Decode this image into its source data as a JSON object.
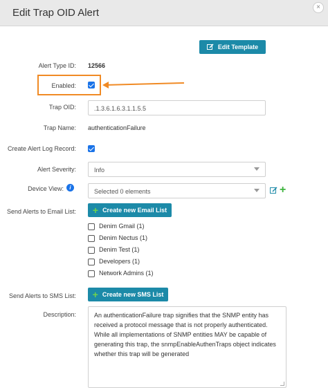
{
  "dialog": {
    "title": "Edit Trap OID Alert",
    "close_icon": "×"
  },
  "toolbar": {
    "edit_template_label": "Edit Template"
  },
  "fields": {
    "alert_type_id_label": "Alert Type ID:",
    "alert_type_id_value": "12566",
    "enabled_label": "Enabled:",
    "enabled_checked": true,
    "trap_oid_label": "Trap OID:",
    "trap_oid_value": ".1.3.6.1.6.3.1.1.5.5",
    "trap_name_label": "Trap Name:",
    "trap_name_value": "authenticationFailure",
    "create_log_label": "Create Alert Log Record:",
    "create_log_checked": true,
    "severity_label": "Alert Severity:",
    "severity_value": "Info",
    "device_view_label": "Device View:",
    "device_view_value": "Selected 0 elements",
    "email_label": "Send Alerts to Email List:",
    "new_email_button": "Create new Email List",
    "sms_label": "Send Alerts to SMS List:",
    "new_sms_button": "Create new SMS List",
    "description_label": "Description:",
    "description_value": "An authenticationFailure trap signifies that the SNMP entity has received a protocol message that is not properly authenticated. While all implementations of SNMP entities MAY be capable of generating this trap, the snmpEnableAuthenTraps object indicates whether this trap will be generated"
  },
  "email_lists": [
    {
      "label": "Denim Gmail (1)",
      "checked": false
    },
    {
      "label": "Denim Nectus (1)",
      "checked": false
    },
    {
      "label": "Denim Test (1)",
      "checked": false
    },
    {
      "label": "Developers (1)",
      "checked": false
    },
    {
      "label": "Network Admins (1)",
      "checked": false
    }
  ],
  "colors": {
    "accent_button": "#1c8aa8",
    "highlight": "#f08a24",
    "checkbox": "#1a73e8",
    "add_green": "#3cb33c"
  }
}
